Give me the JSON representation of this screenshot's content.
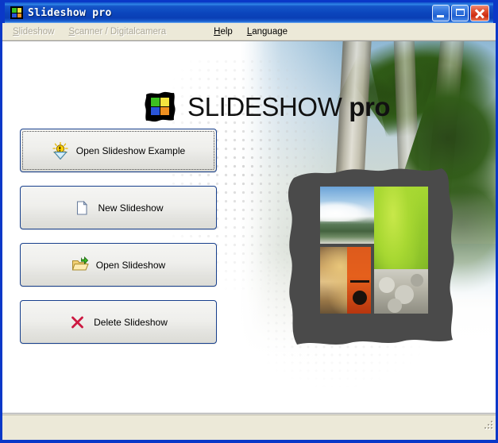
{
  "window": {
    "title": "Slideshow pro",
    "title_icon": "app-logo-icon",
    "controls": {
      "minimize": "Minimize",
      "maximize": "Maximize",
      "close": "Close"
    }
  },
  "menubar": {
    "items": [
      {
        "label": "Slideshow",
        "mnemonic": "S",
        "enabled": false
      },
      {
        "label": "Scanner / Digitalcamera",
        "mnemonic": "S",
        "enabled": false
      },
      {
        "label": "Help",
        "mnemonic": "H",
        "enabled": true
      },
      {
        "label": "Language",
        "mnemonic": "L",
        "enabled": true
      }
    ]
  },
  "brand": {
    "name_main": "SLIDESHOW",
    "name_pro": "pro",
    "logo": "four-color-frame-logo"
  },
  "buttons": [
    {
      "label": "Open Slideshow Example",
      "icon": "lightbulb-icon",
      "focused": true
    },
    {
      "label": "New Slideshow",
      "icon": "new-document-icon",
      "focused": false
    },
    {
      "label": "Open Slideshow",
      "icon": "open-folder-icon",
      "focused": false
    },
    {
      "label": "Delete Slideshow",
      "icon": "red-x-icon",
      "focused": false
    }
  ],
  "statusbar": {
    "text": "",
    "resize_grip": "resize-grip-icon"
  },
  "colors": {
    "titlebar_blue": "#0a46bd",
    "window_border": "#0a38c8",
    "menubar_beige": "#ece9d8",
    "button_border": "#173f8c",
    "close_red": "#cc2a10",
    "delete_x_red": "#cc1840",
    "logo_green": "#38c020",
    "logo_yellow": "#f2e23c",
    "logo_blue": "#2a55d8",
    "logo_orange": "#f09020",
    "frame_gray": "#4a4a4a"
  }
}
